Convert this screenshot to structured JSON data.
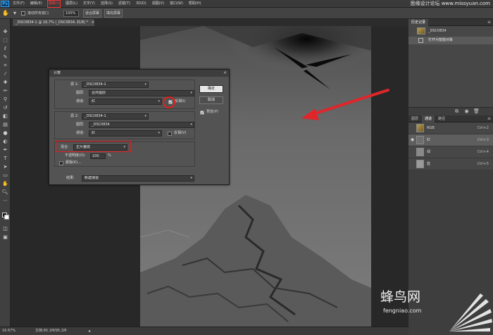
{
  "app": {
    "logo": "Ps",
    "watermark_top": "思缘设计论坛 www.missyuan.com"
  },
  "menu": {
    "items": [
      "文件(F)",
      "编辑(E)",
      "图像(I)",
      "图层(L)",
      "文字(Y)",
      "选择(S)",
      "滤镜(T)",
      "3D(D)",
      "视图(V)",
      "窗口(W)",
      "帮助(H)"
    ],
    "active_index": 2
  },
  "options": {
    "scroll_all_label": "滚动所有窗口",
    "zoom_value": "100%",
    "fit_screen": "适合屏幕",
    "fill_screen": "填充屏幕"
  },
  "document": {
    "tab_title": "_DSC0834-1 @ 16.7% (_DSC0834, 红/8) *",
    "close_glyph": "×"
  },
  "status": {
    "zoom": "16.67%",
    "doc_info": "文档:95.1M/95.1M",
    "arrow": "▸"
  },
  "history": {
    "tabs": [
      "历史记录"
    ],
    "snapshot": "_DSC0834",
    "state": "打开为智能对象"
  },
  "channels": {
    "tabs": [
      "图层",
      "通道",
      "路径"
    ],
    "active_tab": 1,
    "rows": [
      {
        "name": "RGB",
        "key": "Ctrl+2"
      },
      {
        "name": "红",
        "key": "Ctrl+3"
      },
      {
        "name": "绿",
        "key": "Ctrl+4"
      },
      {
        "name": "蓝",
        "key": "Ctrl+5"
      }
    ],
    "selected_index": 1
  },
  "dialog": {
    "title": "计算",
    "close_glyph": "×",
    "source1": {
      "label": "源 1:",
      "value": "_DSC0834-1",
      "layer_label": "图层:",
      "layer_value": "合并图层",
      "channel_label": "通道:",
      "channel_value": "红",
      "invert_label": "反相(I)",
      "invert_checked": true
    },
    "source2": {
      "label": "源 2:",
      "value": "_DSC0834-1",
      "layer_label": "图层:",
      "layer_value": "_DSC0834",
      "channel_label": "通道:",
      "channel_value": "红",
      "invert_label": "反相(V)",
      "invert_checked": false
    },
    "blending": {
      "label": "混合:",
      "value": "正片叠底",
      "opacity_label": "不透明度(O):",
      "opacity_value": "100",
      "opacity_unit": "%",
      "mask_label": "蒙版(K)..."
    },
    "result": {
      "label": "结果:",
      "value": "新建通道"
    },
    "buttons": {
      "ok": "确定",
      "cancel": "取消",
      "preview": "预览(P)"
    }
  },
  "watermark_bottom": {
    "text": "蜂鸟网",
    "url": "fengniao.com"
  }
}
